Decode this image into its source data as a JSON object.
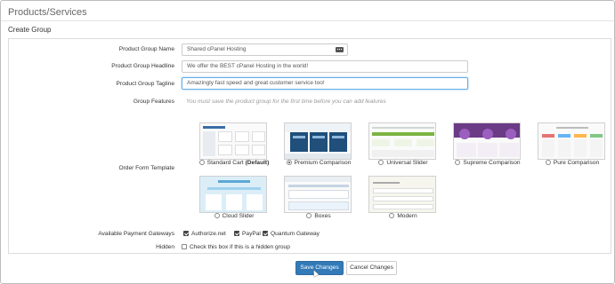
{
  "page": {
    "title": "Products/Services",
    "section": "Create Group"
  },
  "form": {
    "group_name": {
      "label": "Product Group Name",
      "value": "Shared cPanel Hosting"
    },
    "headline": {
      "label": "Product Group Headline",
      "value": "We offer the BEST cPanel Hosting in the world!"
    },
    "tagline": {
      "label": "Product Group Tagline",
      "value": "Amazingly fast speed and great customer service too!"
    },
    "features": {
      "label": "Group Features",
      "note": "You must save the product group for the first time before you can add features"
    },
    "order_form": {
      "label": "Order Form Template",
      "templates": [
        {
          "name": "Standard Cart",
          "suffix": "(Default)",
          "selected": false
        },
        {
          "name": "Premium Comparison",
          "suffix": "",
          "selected": true
        },
        {
          "name": "Universal Slider",
          "suffix": "",
          "selected": false
        },
        {
          "name": "Supreme Comparison",
          "suffix": "",
          "selected": false
        },
        {
          "name": "Pure Comparison",
          "suffix": "",
          "selected": false
        },
        {
          "name": "Cloud Slider",
          "suffix": "",
          "selected": false
        },
        {
          "name": "Boxes",
          "suffix": "",
          "selected": false
        },
        {
          "name": "Modern",
          "suffix": "",
          "selected": false
        }
      ]
    },
    "gateways": {
      "label": "Available Payment Gateways",
      "options": [
        {
          "name": "Authorize.net",
          "checked": true
        },
        {
          "name": "PayPal",
          "checked": true
        },
        {
          "name": "Quantum Gateway",
          "checked": true
        }
      ]
    },
    "hidden": {
      "label": "Hidden",
      "text": "Check this box if this is a hidden group",
      "checked": false
    }
  },
  "actions": {
    "save": "Save Changes",
    "cancel": "Cancel Changes"
  },
  "colors": {
    "primary": "#337ab7",
    "focus": "#66afe9",
    "purple": "#6b3b86"
  }
}
